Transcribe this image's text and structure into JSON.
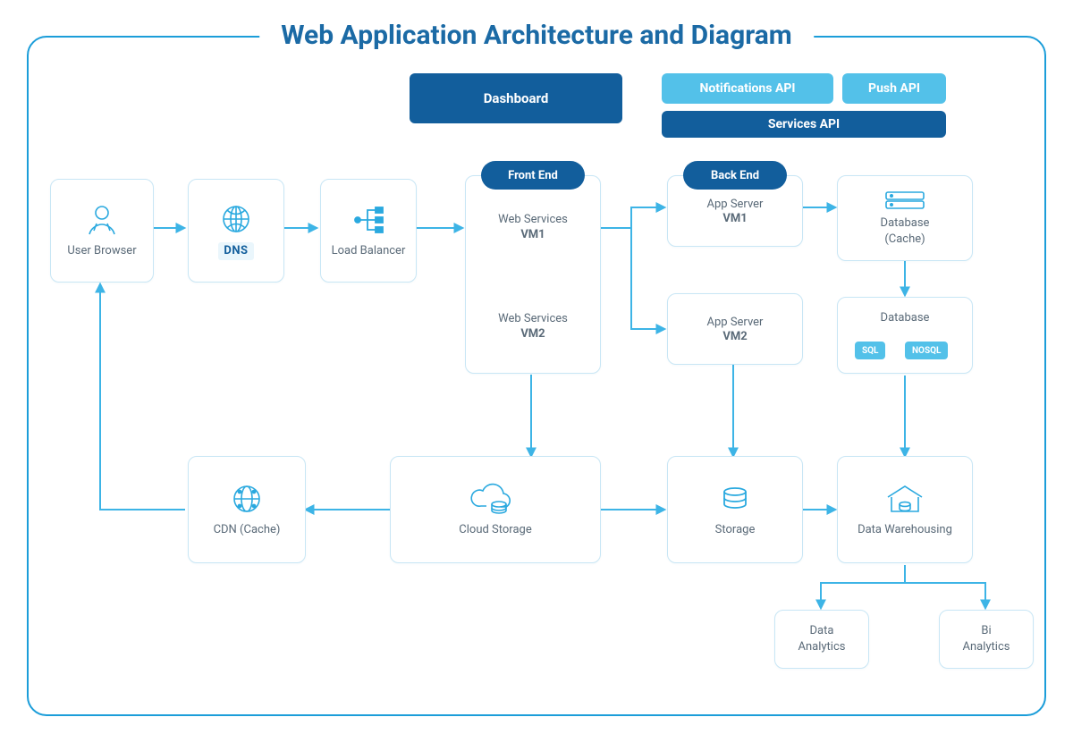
{
  "title": "Web Application Architecture and Diagram",
  "header": {
    "dashboard": "Dashboard",
    "notifications": "Notifications API",
    "push": "Push API",
    "services": "Services API"
  },
  "badges": {
    "frontend": "Front End",
    "backend": "Back End"
  },
  "nodes": {
    "userBrowser": "User Browser",
    "dns": "DNS",
    "loadBalancer": "Load Balancer",
    "webServices": "Web Services",
    "vm1": "VM1",
    "vm2": "VM2",
    "appServer": "App Server",
    "databaseCache": "Database\n(Cache)",
    "database": "Database",
    "sql": "SQL",
    "nosql": "NOSQL",
    "cdnCache": "CDN (Cache)",
    "cloudStorage": "Cloud Storage",
    "storage": "Storage",
    "dataWarehousing": "Data Warehousing",
    "dataAnalytics": "Data\nAnalytics",
    "biAnalytics": "Bi\nAnalytics"
  },
  "colors": {
    "primary": "#125e9c",
    "accent": "#53c1e9",
    "outline": "#1b9dd9"
  }
}
